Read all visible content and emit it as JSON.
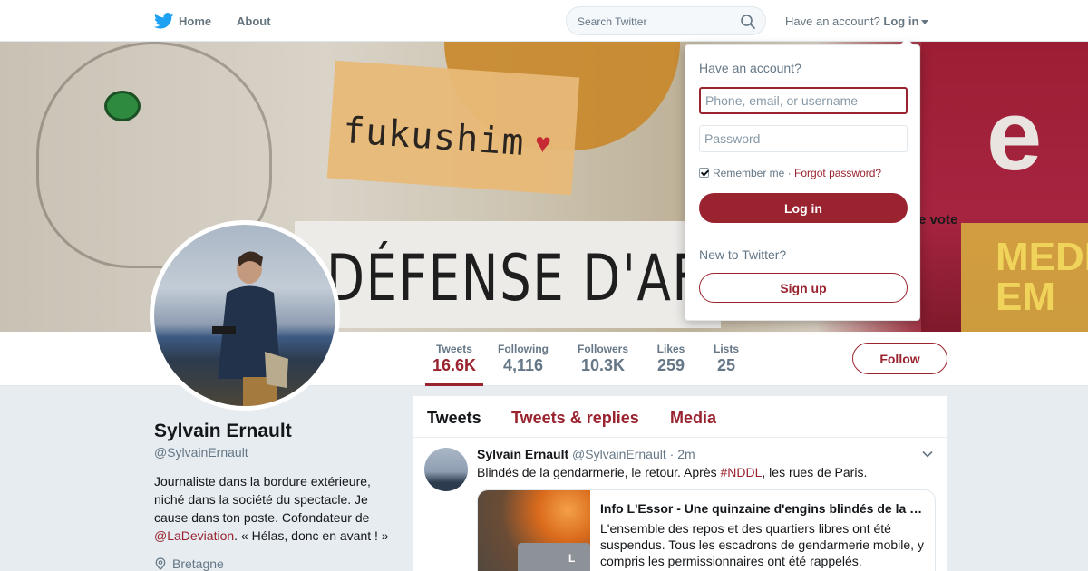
{
  "nav": {
    "home_label": "Home",
    "about_label": "About",
    "search_placeholder": "Search Twitter",
    "account_prompt": "Have an account?",
    "login_label": "Log in"
  },
  "banner": {
    "fukushima_text": "fukushim",
    "sign_text": "DÉFENSE D'AFFICH",
    "vote_text": "e vote",
    "poster_letter": "e",
    "poster_media": "MEDI\nEM"
  },
  "profile": {
    "name": "Sylvain Ernault",
    "handle": "@SylvainErnault",
    "bio_text": "Journaliste dans la bordure extérieure, niché dans la société du spectacle. Je cause dans ton poste. Cofondateur de ",
    "bio_link": "@LaDeviation",
    "bio_end": ". « Hélas, donc en avant ! »",
    "location": "Bretagne"
  },
  "stats": [
    {
      "label": "Tweets",
      "value": "16.6K"
    },
    {
      "label": "Following",
      "value": "4,116"
    },
    {
      "label": "Followers",
      "value": "10.3K"
    },
    {
      "label": "Likes",
      "value": "259"
    },
    {
      "label": "Lists",
      "value": "25"
    }
  ],
  "follow_label": "Follow",
  "timeline": {
    "tabs": [
      "Tweets",
      "Tweets & replies",
      "Media"
    ],
    "tweet": {
      "name": "Sylvain Ernault",
      "handle": "@SylvainErnault",
      "time": "· 2m",
      "text_before": "Blindés de la gendarmerie, le retour. Après ",
      "hashtag": "#NDDL",
      "text_after": ", les rues de Paris.",
      "card_title": "Info L'Essor - Une quinzaine d'engins blindés de la …",
      "card_desc": "L'ensemble des repos et des quartiers libres ont été suspendus. Tous les escadrons de gendarmerie mobile, y compris les permissionnaires ont été rappelés.",
      "card_image_letter": "L"
    }
  },
  "login": {
    "heading": "Have an account?",
    "username_placeholder": "Phone, email, or username",
    "password_placeholder": "Password",
    "remember_label": "Remember me",
    "separator": "·",
    "forgot_label": "Forgot password?",
    "login_button": "Log in",
    "new_prompt": "New to Twitter?",
    "signup_button": "Sign up"
  },
  "colors": {
    "accent": "#99232f",
    "twitter_blue": "#1da1f2",
    "background": "#e6ecf0",
    "muted_text": "#657786"
  }
}
